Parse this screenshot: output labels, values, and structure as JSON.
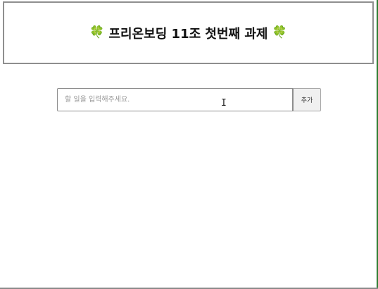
{
  "header": {
    "title": "프리온보딩 11조 첫번째 과제",
    "left_icon": "four-leaf-clover",
    "right_icon": "four-leaf-clover",
    "icon_glyph": "🍀"
  },
  "todo_form": {
    "input_placeholder": "할 일을 입력해주세요.",
    "input_value": "",
    "add_button_label": "추가"
  },
  "cursor": {
    "icon": "text-cursor",
    "glyph": "I"
  }
}
